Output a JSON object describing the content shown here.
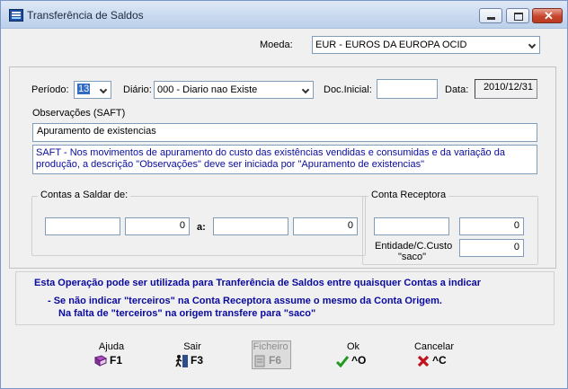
{
  "window": {
    "title": "Transferência de Saldos"
  },
  "moeda": {
    "label": "Moeda:",
    "value": "EUR - EUROS DA EUROPA OCID"
  },
  "periodo": {
    "label": "Período:",
    "value": "13"
  },
  "diario": {
    "label": "Diário:",
    "value": "000 - Diario nao Existe"
  },
  "doc_inicial": {
    "label": "Doc.Inicial:",
    "value": ""
  },
  "data": {
    "label": "Data:",
    "value": "2010/12/31"
  },
  "observacoes": {
    "label": "Observações (SAFT)",
    "value": "Apuramento de existencias",
    "note": "SAFT - Nos movimentos de apuramento do custo das existências vendidas e consumidas e da variação da produção, a descrição \"Observações\" deve ser iniciada por \"Apuramento de existencias\""
  },
  "contas_saldar": {
    "label": "Contas a Saldar de:",
    "from_account": "",
    "from_value": "0",
    "to_label": "a:",
    "to_account": "",
    "to_value": "0"
  },
  "conta_receptora": {
    "label": "Conta Receptora",
    "account": "",
    "value": "0",
    "entidade_label_1": "Entidade/C.Custo",
    "entidade_label_2": "\"saco\"",
    "entidade_value": "0"
  },
  "info": {
    "line1": "Esta Operação pode ser utilizada para Tranferência de Saldos entre quaisquer Contas a indicar",
    "line2": "- Se não indicar \"terceiros\" na Conta Receptora assume o mesmo da Conta Origem.",
    "line3": "Na falta de \"terceiros\" na origem transfere para  \"saco\""
  },
  "toolbar": {
    "ajuda": {
      "label": "Ajuda",
      "key": "F1",
      "icon": "help-book-icon"
    },
    "sair": {
      "label": "Sair",
      "key": "F3",
      "icon": "exit-door-icon"
    },
    "ficheiro": {
      "label": "Ficheiro",
      "key": "F6",
      "icon": "file-icon",
      "enabled": false
    },
    "ok": {
      "label": "Ok",
      "key": "^O",
      "icon": "checkmark-icon"
    },
    "cancelar": {
      "label": "Cancelar",
      "key": "^C",
      "icon": "x-mark-icon"
    }
  },
  "colors": {
    "info_text": "#0a0a9e",
    "ok_green": "#1f9a1f",
    "cancel_red": "#c0141c"
  }
}
